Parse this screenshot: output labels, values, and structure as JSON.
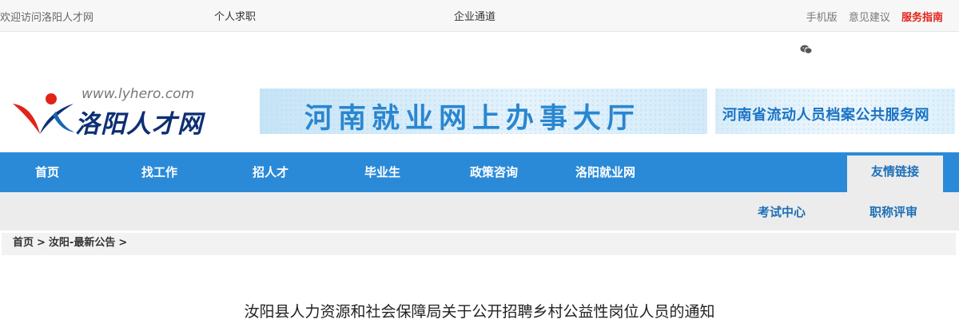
{
  "topbar": {
    "welcome": "欢迎访问洛阳人才网",
    "personal": "个人求职",
    "enterprise": "企业通道",
    "mobile": "手机版",
    "feedback": "意见建议",
    "guide": "服务指南"
  },
  "header": {
    "logo_url": "www.lyhero.com",
    "logo_name": "洛阳人才网",
    "banner_employment": "河南就业网上办事大厅",
    "banner_archives": "河南省流动人员档案公共服务网"
  },
  "nav": {
    "items": [
      "首页",
      "找工作",
      "招人才",
      "毕业生",
      "政策咨询",
      "洛阳就业网"
    ],
    "friends": "友情链接"
  },
  "subnav": {
    "exam": "考试中心",
    "title_eval": "职称评审"
  },
  "breadcrumb": {
    "home": "首页",
    "sep": ">",
    "section": "汝阳-最新公告"
  },
  "article": {
    "title": "汝阳县人力资源和社会保障局关于公开招聘乡村公益性岗位人员的通知"
  },
  "colors": {
    "nav_blue": "#2b8ad8",
    "link_blue": "#1e6fb8",
    "guide_red": "#e2231a",
    "logo_navy": "#0d2f74",
    "logo_red": "#e2231a"
  },
  "icons": [
    "wechat-icon",
    "logo-figure-icon"
  ]
}
